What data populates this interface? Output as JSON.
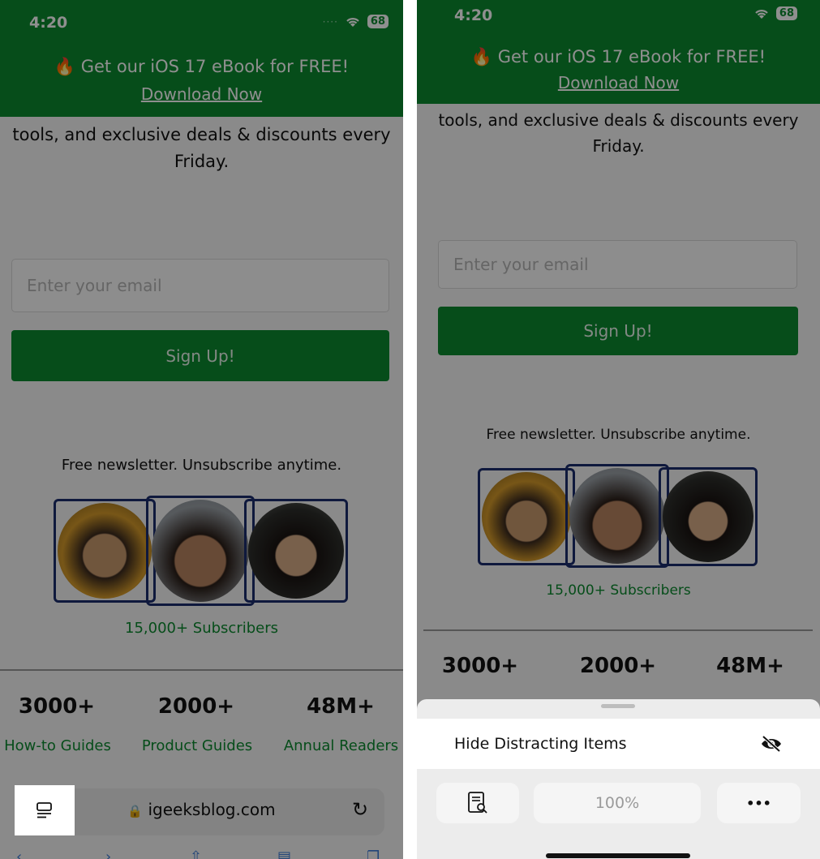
{
  "status": {
    "time": "4:20",
    "battery": "68"
  },
  "banner": {
    "promo": "🔥 Get our iOS 17 eBook for FREE!",
    "link": "Download Now"
  },
  "newsletter": {
    "paragraph_line1": "tools, and exclusive deals & discounts every",
    "paragraph_line2": "Friday.",
    "email_placeholder": "Enter your email",
    "signup_label": "Sign Up!",
    "note": "Free newsletter. Unsubscribe anytime.",
    "subscribers": "15,000+ Subscribers"
  },
  "stats": [
    {
      "value": "3000+",
      "label": "How-to Guides"
    },
    {
      "value": "2000+",
      "label": "Product Guides"
    },
    {
      "value": "48M+",
      "label": "Annual Readers"
    }
  ],
  "browser": {
    "url": "igeeksblog.com"
  },
  "menu": {
    "hide_items": "Hide Distracting Items",
    "zoom": "100%",
    "more": "•••"
  },
  "colors": {
    "brand_green": "#0c8a2f",
    "avatar_frame": "#1c2d6e"
  }
}
